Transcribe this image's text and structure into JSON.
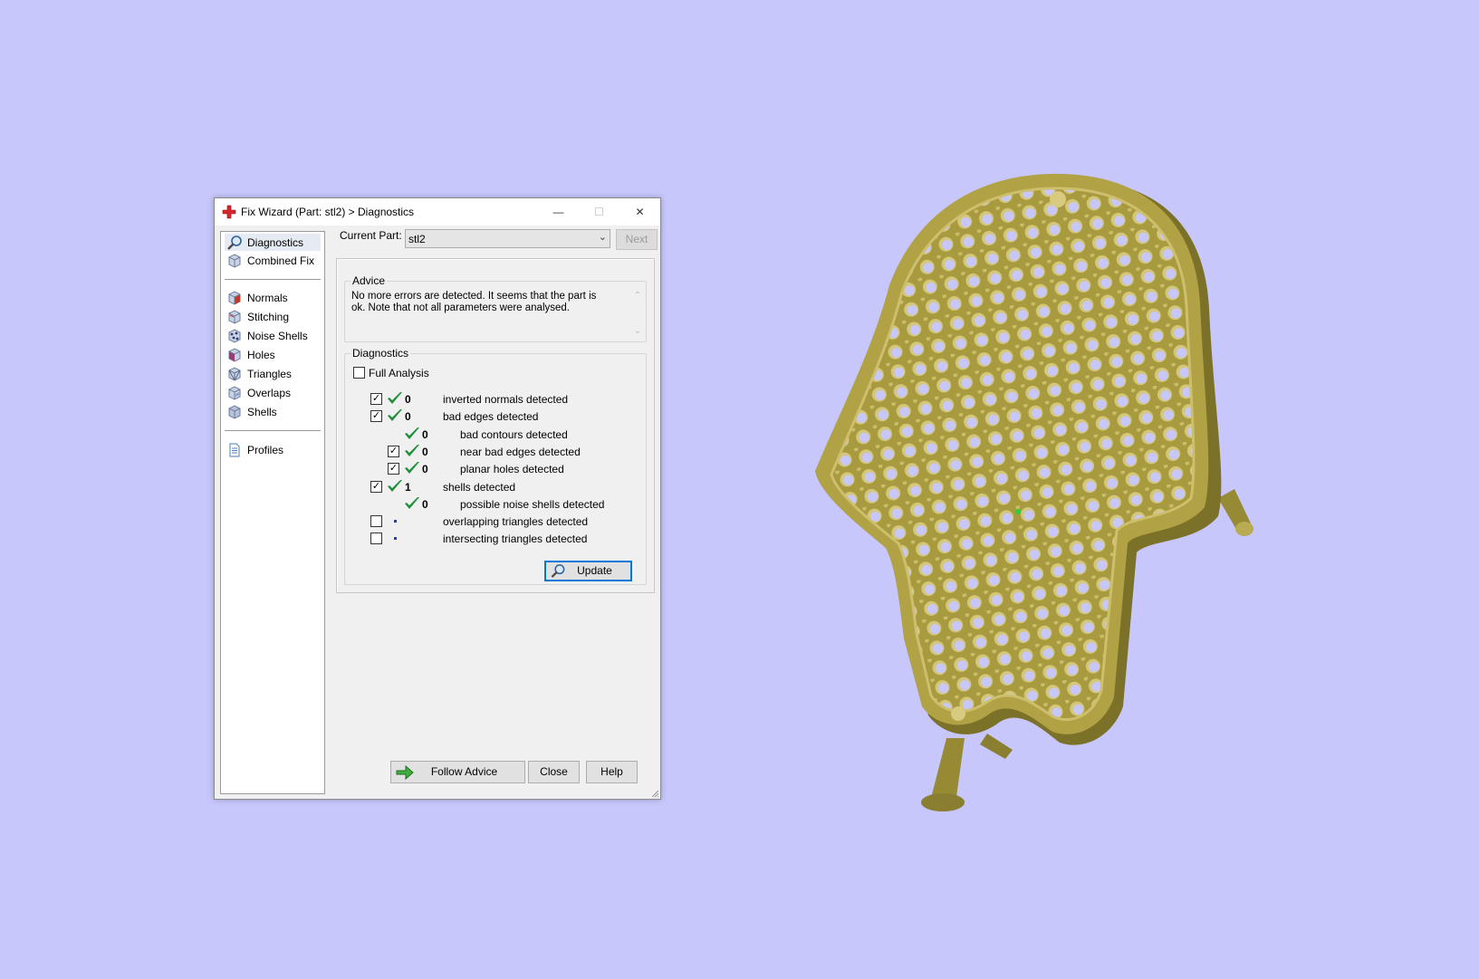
{
  "window": {
    "title": "Fix Wizard (Part: stl2) > Diagnostics",
    "minimize_icon": "minimize-icon",
    "maximize_icon": "maximize-icon",
    "close_icon": "close-icon",
    "minimize_glyph": "—",
    "maximize_glyph": "☐",
    "close_glyph": "✕"
  },
  "sidebar": {
    "group1": [
      {
        "label": "Diagnostics",
        "icon": "magnifier-icon",
        "selected": true
      },
      {
        "label": "Combined Fix",
        "icon": "cube-icon"
      }
    ],
    "group2": [
      {
        "label": "Normals",
        "icon": "normals-cube-icon"
      },
      {
        "label": "Stitching",
        "icon": "stitching-cube-icon"
      },
      {
        "label": "Noise Shells",
        "icon": "noise-shells-icon"
      },
      {
        "label": "Holes",
        "icon": "holes-cube-icon"
      },
      {
        "label": "Triangles",
        "icon": "triangles-cube-icon"
      },
      {
        "label": "Overlaps",
        "icon": "overlaps-cube-icon"
      },
      {
        "label": "Shells",
        "icon": "shells-cube-icon"
      }
    ],
    "group3": [
      {
        "label": "Profiles",
        "icon": "document-icon"
      }
    ]
  },
  "current_part": {
    "label": "Current Part:",
    "value": "stl2",
    "next_label": "Next"
  },
  "advice": {
    "title": "Advice",
    "text": "No more errors are detected. It seems that the part is ok. Note that not all parameters were analysed."
  },
  "diagnostics": {
    "title": "Diagnostics",
    "full_analysis_label": "Full Analysis",
    "full_analysis_checked": false,
    "rows": [
      {
        "checkbox": true,
        "checked": true,
        "status": "ok",
        "count": "0",
        "label": "inverted normals detected",
        "indent": 0
      },
      {
        "checkbox": true,
        "checked": true,
        "status": "ok",
        "count": "0",
        "label": "bad edges detected",
        "indent": 0
      },
      {
        "checkbox": false,
        "checked": false,
        "status": "ok",
        "count": "0",
        "label": "bad contours detected",
        "indent": 1
      },
      {
        "checkbox": true,
        "checked": true,
        "status": "ok",
        "count": "0",
        "label": "near bad edges detected",
        "indent": 1
      },
      {
        "checkbox": true,
        "checked": true,
        "status": "ok",
        "count": "0",
        "label": "planar holes detected",
        "indent": 1
      },
      {
        "checkbox": true,
        "checked": true,
        "status": "ok",
        "count": "1",
        "label": "shells detected",
        "indent": 0
      },
      {
        "checkbox": false,
        "checked": false,
        "status": "ok",
        "count": "0",
        "label": "possible noise shells detected",
        "indent": 1
      },
      {
        "checkbox": true,
        "checked": false,
        "status": "pending",
        "count": "",
        "label": "overlapping triangles detected",
        "indent": 0
      },
      {
        "checkbox": true,
        "checked": false,
        "status": "pending",
        "count": "",
        "label": "intersecting triangles detected",
        "indent": 0
      }
    ],
    "update_label": "Update"
  },
  "footer": {
    "follow_advice_label": "Follow Advice",
    "close_label": "Close",
    "help_label": "Help"
  },
  "colors": {
    "background": "#c7c7fb",
    "model_gold": "#a89a3e",
    "check_green": "#1f8f3a",
    "pending_dot": "#1a3fc0"
  }
}
